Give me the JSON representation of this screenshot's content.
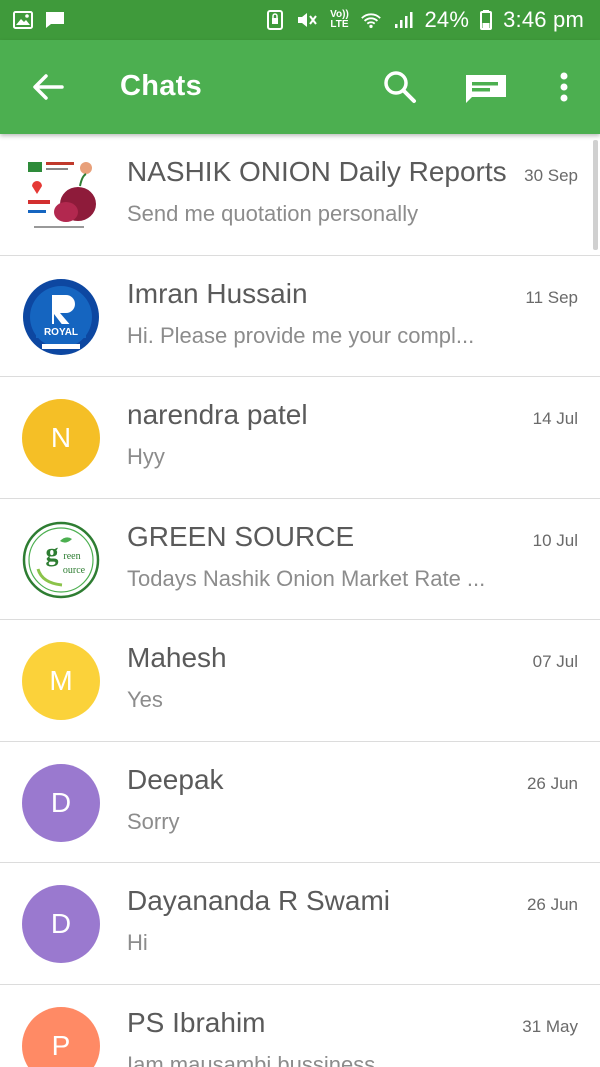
{
  "statusbar": {
    "volte_line1": "Vo))",
    "volte_line2": "LTE",
    "battery": "24%",
    "time": "3:46 pm"
  },
  "appbar": {
    "title": "Chats",
    "color": "#4caf50"
  },
  "chats": [
    {
      "name": "NASHIK ONION Daily Reports",
      "date": "30 Sep",
      "preview": "Send me quotation personally",
      "avatar": "nashik-onion-logo"
    },
    {
      "name": "Imran Hussain",
      "date": "11 Sep",
      "preview": "Hi. Please provide me your  compl...",
      "avatar": "royal-logo",
      "avatar_text": "ROYAL"
    },
    {
      "name": "narendra patel",
      "date": "14 Jul",
      "preview": "Hyy",
      "avatar_letter": "N",
      "avatar_color": "#f5bf26"
    },
    {
      "name": "GREEN SOURCE",
      "date": "10 Jul",
      "preview": "Todays Nashik Onion Market Rate ...",
      "avatar": "green-source-logo",
      "avatar_text1": "g",
      "avatar_text2": "reen",
      "avatar_text3": "ource"
    },
    {
      "name": "Mahesh",
      "date": "07 Jul",
      "preview": "Yes",
      "avatar_letter": "M",
      "avatar_color": "#fbd23a"
    },
    {
      "name": "Deepak",
      "date": "26 Jun",
      "preview": "Sorry",
      "avatar_letter": "D",
      "avatar_color": "#9a79cf"
    },
    {
      "name": "Dayananda R Swami",
      "date": "26 Jun",
      "preview": "Hi",
      "avatar_letter": "D",
      "avatar_color": "#9a79cf"
    },
    {
      "name": "PS Ibrahim",
      "date": "31 May",
      "preview": "Iam mausambi bussiness",
      "avatar_letter": "P",
      "avatar_color": "#ff8a65"
    }
  ]
}
